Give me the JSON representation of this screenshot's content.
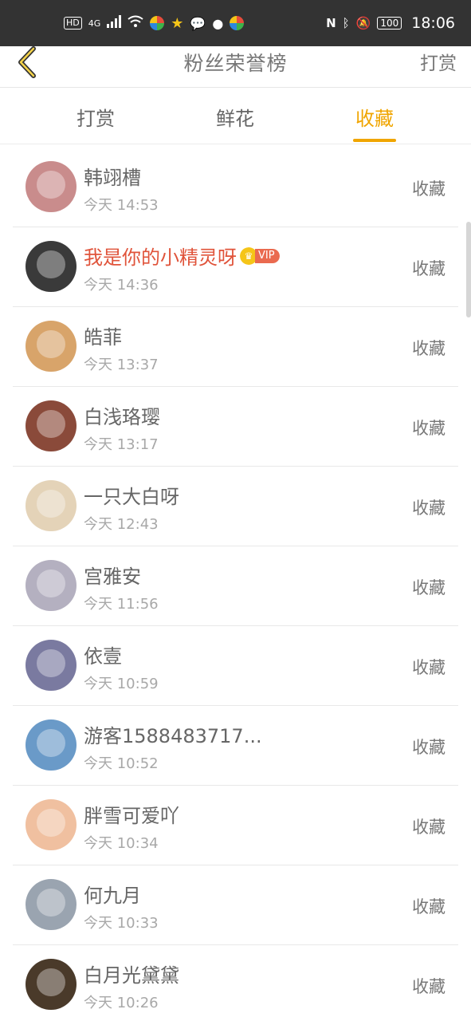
{
  "status_bar": {
    "left_badges": [
      "HD",
      "4G"
    ],
    "time": "18:06",
    "battery": "100",
    "colors": {
      "bg": "#333333",
      "icon_green": "#3cb34a",
      "icon_star": "#f5c518"
    }
  },
  "header": {
    "back_icon": "chevron-left-icon",
    "title": "粉丝荣誉榜",
    "action_label": "打赏"
  },
  "tabs": [
    {
      "label": "打赏",
      "active": false
    },
    {
      "label": "鲜花",
      "active": false
    },
    {
      "label": "收藏",
      "active": true
    }
  ],
  "accent_color": "#f0a500",
  "list": [
    {
      "name": "韩翊槽",
      "time": "今天 14:53",
      "action": "收藏",
      "avatar_color": "#c98c8c",
      "vip": false
    },
    {
      "name": "我是你的小精灵呀",
      "time": "今天 14:36",
      "action": "收藏",
      "avatar_color": "#3a3a3a",
      "vip": true,
      "vip_label": "VIP"
    },
    {
      "name": "皓菲",
      "time": "今天 13:37",
      "action": "收藏",
      "avatar_color": "#d8a46a",
      "vip": false
    },
    {
      "name": "白浅珞璎",
      "time": "今天 13:17",
      "action": "收藏",
      "avatar_color": "#8a4a3a",
      "vip": false
    },
    {
      "name": "一只大白呀",
      "time": "今天 12:43",
      "action": "收藏",
      "avatar_color": "#e4d3b8",
      "vip": false
    },
    {
      "name": "宫雅安",
      "time": "今天 11:56",
      "action": "收藏",
      "avatar_color": "#b4b0c0",
      "vip": false
    },
    {
      "name": "依壹",
      "time": "今天 10:59",
      "action": "收藏",
      "avatar_color": "#7a7aa0",
      "vip": false
    },
    {
      "name": "游客1588483717...",
      "time": "今天 10:52",
      "action": "收藏",
      "avatar_color": "#6a9ac8",
      "vip": false
    },
    {
      "name": "胖雪可爱吖",
      "time": "今天 10:34",
      "action": "收藏",
      "avatar_color": "#f0c0a0",
      "vip": false
    },
    {
      "name": "何九月",
      "time": "今天 10:33",
      "action": "收藏",
      "avatar_color": "#9aa4b0",
      "vip": false
    },
    {
      "name": "白月光黛黛",
      "time": "今天 10:26",
      "action": "收藏",
      "avatar_color": "#4a3a2a",
      "vip": false
    }
  ]
}
